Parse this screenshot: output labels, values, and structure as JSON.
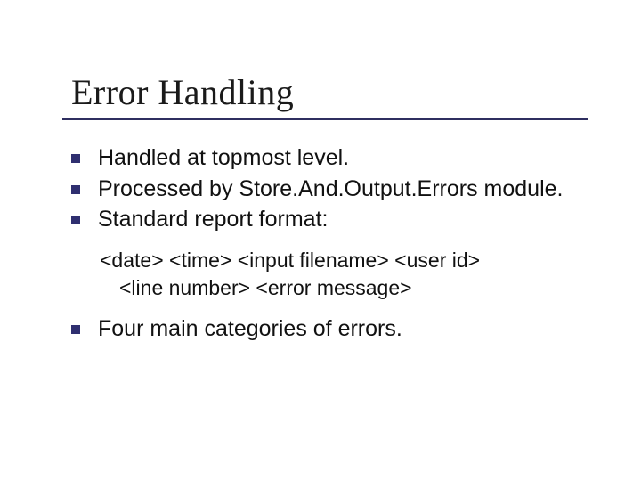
{
  "title": "Error Handling",
  "bullets": {
    "b1": "Handled at topmost level.",
    "b2": "Processed by Store.And.Output.Errors module.",
    "b3": "Standard report format:",
    "b4": "Four main categories of errors."
  },
  "report_format": {
    "line1": "<date> <time> <input filename> <user id>",
    "line2": "<line number> <error message>"
  }
}
